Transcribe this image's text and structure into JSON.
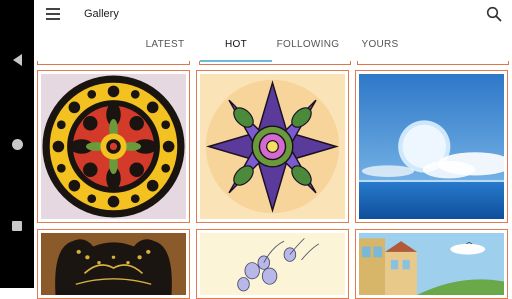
{
  "app": {
    "title": "Gallery"
  },
  "tabs": [
    {
      "label": "LATEST",
      "active": false
    },
    {
      "label": "HOT",
      "active": true
    },
    {
      "label": "FOLLOWING",
      "active": false
    },
    {
      "label": "YOURS",
      "active": false
    }
  ],
  "system_nav": {
    "icons": [
      "back-icon",
      "home-icon",
      "recents-icon"
    ]
  },
  "gallery": {
    "items": [
      {
        "subject": "mandala-red-yellow"
      },
      {
        "subject": "purple-flower-mandala"
      },
      {
        "subject": "moon-over-ocean"
      },
      {
        "subject": "bear-pattern"
      },
      {
        "subject": "floral-sketch"
      },
      {
        "subject": "seaside-town"
      }
    ]
  },
  "colors": {
    "accent_underline": "#6cb9d8",
    "card_border": "#e27b4f"
  }
}
